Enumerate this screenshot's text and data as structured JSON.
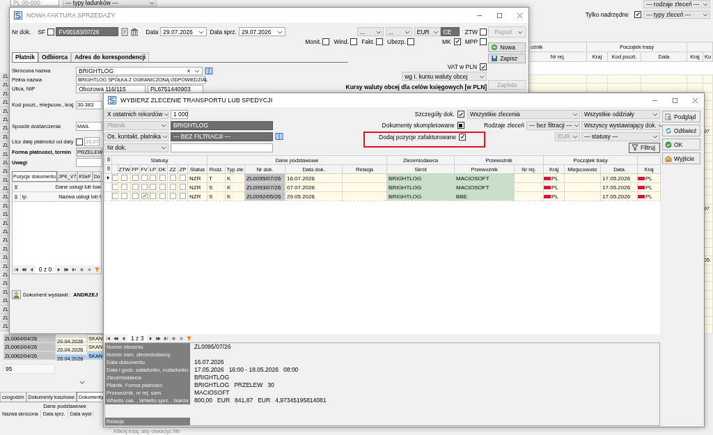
{
  "background": {
    "postal_code": {
      "placeholder": "PL 00-000"
    },
    "cargo_types": "--- typy ładunków ---",
    "order_kinds": "--- rodzaje zleceń ---",
    "top_level_only": {
      "label": "Tylko nadrzędne",
      "checked": true
    },
    "order_types": "--- typy zleceń ---",
    "grid": {
      "groups": [
        "oźnik",
        "Początek trasy"
      ],
      "columns": [
        "Nr rej.",
        "Kraj",
        "Kod poczt.",
        "Data",
        "Kraj",
        "Ko"
      ],
      "edge_values": [
        "97",
        "97",
        "05-"
      ]
    },
    "row_stubs": [
      "ZL",
      "ZL",
      "ZL",
      "ZL",
      "ZL",
      "ZL",
      "ZL",
      "ZL",
      "ZL",
      "ZL",
      "ZL",
      "ZL",
      "ZL",
      "ZL",
      "ZL",
      "ZL",
      "ZL",
      "ZL",
      "ZL",
      "ZL",
      "ZL",
      "ZL",
      "ZL",
      "ZL",
      "ZL",
      "ZL",
      "ZL",
      "ZL",
      "ZL",
      "ZL"
    ],
    "orders": [
      {
        "number": "ZL0064/04/26",
        "date": "20.04.2026",
        "client": "SKAN",
        "selected": false
      },
      {
        "number": "ZL0063/04/26",
        "date": "20.04.2026",
        "client": "SKAN",
        "selected": false
      },
      {
        "number": "ZL0062/04/26",
        "date": "20.04.2026",
        "client": "SKAN",
        "selected": true
      }
    ],
    "count": "95",
    "tabs": [
      {
        "label": "czogodzin",
        "selected": false
      },
      {
        "label": "Dokumenty kosztowe",
        "selected": false
      },
      {
        "label": "Dokumenty",
        "selected": true
      }
    ],
    "section_header": "Dane podstawowe",
    "columns": [
      "Nazwa skrócona",
      "Data sprz.",
      "Data wyst"
    ],
    "filter_hint": "Kliknij tutaj, aby utworzyć filtr"
  },
  "invoice_window": {
    "title": "NOWA FAKTURA SPRZEDAŻY",
    "doc_number": {
      "label": "Nr dok.",
      "sf_label": "SF",
      "sf_checked": false,
      "value": "FV00183/07/26"
    },
    "date": {
      "label": "Data",
      "value": "29.07.2026"
    },
    "sale_date": {
      "label": "Data sprz.",
      "value": "29.07.2026"
    },
    "selectors": [
      "...",
      "...",
      "EUR"
    ],
    "currency_code": "CE",
    "ztw": {
      "label": "ZTW",
      "checked": false
    },
    "flags": [
      {
        "label": "Monit.",
        "checked": false
      },
      {
        "label": "Wind.",
        "checked": false
      },
      {
        "label": "Fakt.",
        "checked": false
      },
      {
        "label": "Ubezp.",
        "checked": false
      }
    ],
    "mk": {
      "label": "MK",
      "checked": true
    },
    "mpp": {
      "label": "MPP",
      "checked": false
    },
    "buttons": [
      {
        "label": "Raport",
        "kind": "split",
        "disabled": true
      },
      {
        "label": "Nowa",
        "kind": "new",
        "disabled": false
      },
      {
        "label": "Zapisz",
        "kind": "save",
        "disabled": false
      },
      {
        "label": "Zapłata",
        "kind": "plain",
        "disabled": true
      }
    ],
    "tabs": [
      {
        "label": "Płatnik",
        "selected": true
      },
      {
        "label": "Odbiorca",
        "selected": false
      },
      {
        "label": "Adres do korespondencji",
        "selected": false
      }
    ],
    "vat_in_pln": {
      "label": "VAT w PLN",
      "checked": true
    },
    "rate_mode": "wg I. kursu waluty obcej",
    "rates_heading": "Kursy waluty obcej dla celów księgowych [w PLN]",
    "fields": [
      {
        "label": "Skrócona nazwa",
        "kind": "combo",
        "values": [
          "BRIGHTLOG"
        ]
      },
      {
        "label": "Pełna nazwa",
        "kind": "single",
        "values": [
          "BRIGHTLOG SPÓŁKA Z OGRANICZONĄ ODPOWIEDZIAL"
        ]
      },
      {
        "label": "Ulica, NIP",
        "kind": "pair",
        "values": [
          "Obozowa 116/115",
          "PL6751440903"
        ]
      },
      {
        "label": "Kod poczt., miejscow., kraj",
        "kind": "short",
        "values": [
          "30-383"
        ]
      }
    ],
    "delivery": {
      "label": "Sposób dostarczenia",
      "value": "MAIL"
    },
    "due_from": {
      "label": "Licz datę płatności od daty",
      "checked": false,
      "value": "29.07"
    },
    "payment": {
      "label": "Forma płatności, termin",
      "value": "PRZELEW"
    },
    "notes": {
      "label": "Uwagi"
    },
    "doc_tabs": [
      {
        "label": "Pozycje dokumentu",
        "selected": true
      },
      {
        "label": "JPK_V7",
        "selected": false
      },
      {
        "label": "KSeF",
        "selected": false
      },
      {
        "label": "Do",
        "selected": false
      }
    ],
    "items_grid": {
      "group": "Dane usługi lub tow",
      "columns": [
        "lp.",
        "Nazwa usługi lub t"
      ]
    },
    "pager": "0 z 0",
    "issued_by": {
      "label": "Dokument wystawił :",
      "name": "ANDRZEJ"
    }
  },
  "dialog": {
    "title": "WYBIERZ ZLECENIE TRANSPORTU LUB SPEDYCJI",
    "filters": [
      {
        "selector": "X ostatnich rekordów",
        "kind": "short",
        "disabled": false,
        "value": "1 000"
      },
      {
        "selector": "Płatnik",
        "kind": "dark",
        "disabled": true,
        "value": "BRIGHTLOG"
      },
      {
        "selector": "Os. kontakt. płatnika",
        "kind": "dark-lookup",
        "disabled": false,
        "value": "--- BEZ FILTRACJI ---"
      },
      {
        "selector": "Nr dok.",
        "kind": "text",
        "disabled": false
      }
    ],
    "options": [
      {
        "label": "Szczegóły dok.",
        "kind": "tick",
        "checked": true,
        "highlighted": false
      },
      {
        "label": "Dokumenty skompletowane",
        "kind": "square",
        "checked": true,
        "highlighted": false
      },
      {
        "label": "Dodaj pozycje zafakturowane",
        "kind": "tick",
        "checked": true,
        "highlighted": true
      }
    ],
    "order_scope": "Wszystkie zlecenia",
    "order_kinds": {
      "label": "Rodzaje zleceń",
      "value": "--- bez filtracji ---"
    },
    "currency": {
      "value": "EUR",
      "disabled": true
    },
    "branches": "Wszystkie oddziały",
    "issuers": "Wszyscy wystawiający dok.",
    "statuses": "--- statusy ---",
    "filter_button": "Filtruj",
    "actions": [
      {
        "label": "Podgląd",
        "kind": "preview"
      },
      {
        "label": "Odśwież",
        "kind": "refresh"
      },
      {
        "label": "OK",
        "kind": "ok"
      },
      {
        "label": "Wyjście",
        "kind": "exit"
      }
    ],
    "grid": {
      "groups": [
        "Statusy",
        "Dane podstawowe",
        "Zleceniodawca",
        "Przewoźnik",
        "Początek trasy"
      ],
      "columns": [
        "ZTW",
        "FP",
        "FV",
        "LP",
        "DK",
        "ZZ",
        "ZP",
        "Status",
        "Rodz.",
        "Typ zle",
        "Nr dok.",
        "Data dok.",
        "Relacja",
        "Skrót",
        "Przewoźnik",
        "Nr rej.",
        "Kraj",
        "Miejscowość",
        "Data",
        "Kraj"
      ],
      "rows": [
        {
          "current": true,
          "marked": false,
          "statuses": [
            {
              "checked": false
            },
            {
              "checked": false
            },
            {
              "checked": false
            },
            {
              "checked": false
            },
            {
              "checked": false
            },
            {
              "checked": false
            },
            {
              "checked": false
            }
          ],
          "status": "NZR",
          "kind_code": "T",
          "type": "K",
          "number": "ZL0095/07/26",
          "date": "16.07.2026",
          "client": "BRIGHTLOG",
          "carrier": "MACIOSOFT",
          "start_country": "PL",
          "start_date": "17.05.2026",
          "end_country": "PL"
        },
        {
          "current": false,
          "marked": false,
          "statuses": [
            {
              "checked": false
            },
            {
              "checked": false
            },
            {
              "checked": false
            },
            {
              "checked": false
            },
            {
              "checked": false
            },
            {
              "checked": false
            },
            {
              "checked": false
            }
          ],
          "status": "NZR",
          "kind_code": "S",
          "type": "K",
          "number": "ZL0093/07/26",
          "date": "07.07.2026",
          "client": "BRIGHTLOG",
          "carrier": "MACIOSOFT",
          "start_country": "PL",
          "start_date": "17.05.2026",
          "end_country": "PL"
        },
        {
          "current": false,
          "marked": false,
          "statuses": [
            {
              "checked": false
            },
            {
              "checked": false
            },
            {
              "checked": true
            },
            {
              "checked": false
            },
            {
              "checked": false
            },
            {
              "checked": false
            },
            {
              "checked": false
            }
          ],
          "status": "NZR",
          "kind_code": "S",
          "type": "K",
          "number": "ZL0092/05/26",
          "date": "29.05.2026",
          "client": "BRIGHTLOG",
          "carrier": "BBE",
          "start_country": "PL",
          "start_date": "17.05.2026",
          "end_country": "PL"
        }
      ]
    },
    "pager": "1 z 3",
    "details": [
      {
        "label": "Numer zlecenia",
        "value": "ZL0095/07/26"
      },
      {
        "label": "Numer zam. zleceniodawcy"
      },
      {
        "label": "Data dokumentu",
        "value": "16.07.2026"
      },
      {
        "label": "Data i godz. załadunku, rozładunku",
        "value": "17.05.2026   16:00 - 18.05.2026   08:00"
      },
      {
        "label": "Zleceniodawca",
        "value": "BRIGHTLOG"
      },
      {
        "label": "Płatnik, Forma płatności",
        "value": "BRIGHTLOG   PRZELEW   30"
      },
      {
        "label": "Przewoźnik, nr rej. sam.",
        "value": "MACIOSOFT"
      },
      {
        "label": "WNetto zak. , WNetto sprz. , Marża",
        "value": "800,00   EUR   841,87   EUR   4,97345195814081"
      },
      {
        "label": "Relacja"
      }
    ]
  }
}
